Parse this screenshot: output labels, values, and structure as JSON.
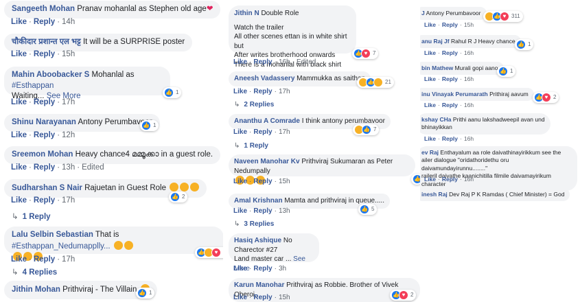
{
  "common": {
    "like": "Like",
    "reply": "Reply",
    "edited": "Edited",
    "see_more": "See More",
    "dot": "·"
  },
  "col1": {
    "c1": {
      "name": "Sangeeth Mohan",
      "text": "Pranav mohanlal as Stephen old age",
      "emoji": "heart",
      "time": "14h"
    },
    "c2": {
      "name": "चौकीदार प्रशान्त एल भट्ट",
      "text": "It will be a SURPRISE poster",
      "time": "15h"
    },
    "c3": {
      "name": "Mahin Aboobacker S",
      "text": "Mohanlal as",
      "tag": "#Esthappan",
      "text2": "Waiting...",
      "time": "17h",
      "reactions": {
        "icons": [
          "like"
        ],
        "count": "1"
      }
    },
    "c4": {
      "name": "Shinu Narayanan",
      "text": "Antony Perumbavoor",
      "time": "12h",
      "reactions": {
        "icons": [
          "like"
        ],
        "count": "1"
      }
    },
    "c5": {
      "name": "Sreemon Mohan",
      "text": "Heavy chance4 മമ്മൂക്കാ in a guest role.",
      "time": "13h"
    },
    "c6": {
      "name": "Sudharshan S Nair",
      "text": "Rajuetan in Guest Role",
      "emoji": "laugh",
      "time": "17h",
      "reactions": {
        "icons": [
          "like"
        ],
        "count": "2"
      },
      "replies": "1 Reply"
    },
    "c7": {
      "name": "Lalu Selbin Sebastian",
      "text": "That is",
      "tag": "#Esthappan_Nedumapplly...",
      "emoji": "love-eyes",
      "time": "17h",
      "reactions": {
        "icons": [
          "like",
          "haha",
          "love"
        ],
        "count": "3"
      },
      "replies": "4 Replies"
    },
    "c8": {
      "name": "Jithin Mohan",
      "text": "Prithviraj - The Villain",
      "emoji": "cool",
      "reactions": {
        "icons": [
          "like"
        ],
        "count": "1"
      }
    }
  },
  "col2": {
    "c1": {
      "name": "Jithin N",
      "text": "Double Role",
      "lines": [
        "Watch the trailer",
        "All other scenes ettan is in white shirt but",
        "After writes brotherhood onwards",
        "There is a mohanlal with black shirt"
      ],
      "time": "16h",
      "reactions": {
        "icons": [
          "like",
          "love"
        ],
        "count": "7"
      }
    },
    "c2": {
      "name": "Aneesh Vadassery",
      "text": "Mammukka as saithan",
      "time": "17h",
      "reactions": {
        "icons": [
          "haha",
          "like",
          "wow"
        ],
        "count": "21"
      },
      "replies": "2 Replies"
    },
    "c3": {
      "name": "Ananthu A Comrade",
      "text": "I think antony perumbavoor",
      "time": "17h",
      "reactions": {
        "icons": [
          "haha",
          "like"
        ],
        "count": "7"
      },
      "replies": "1 Reply"
    },
    "c4": {
      "name": "Naveen Manohar Kv",
      "text": "Prithviraj Sukumaran as Peter Nedumpally",
      "emoji": "love-eyes",
      "time": "15h",
      "reactions": {
        "icons": [
          "like"
        ],
        "count": ""
      }
    },
    "c5": {
      "name": "Amal Krishnan",
      "text": "Mamta and prithviraj in queue.....",
      "time": "13h",
      "reactions": {
        "icons": [
          "like"
        ],
        "count": "5"
      },
      "replies": "3 Replies"
    },
    "c6": {
      "name": "Hasiq Ashique",
      "text": "No",
      "lines": [
        "Charector #27",
        "Land master car ..."
      ],
      "time": "3h"
    },
    "c7": {
      "name": "Karun Manohar",
      "text": "Prithviraj as Robbie. Brother of Vivek Oberoi.",
      "time": "15h",
      "reactions": {
        "icons": [
          "like",
          "love"
        ],
        "count": "2"
      }
    }
  },
  "col3": {
    "c1": {
      "name": "J",
      "text": "Antony Perumbavoor",
      "time": "15h",
      "reactions": {
        "icons": [
          "haha",
          "like",
          "love"
        ],
        "count": "311"
      }
    },
    "c2": {
      "name": "anu Raj Jf",
      "text": "Rahul R J Heavy chance",
      "time": "16h",
      "reactions": {
        "icons": [
          "like"
        ],
        "count": "1"
      }
    },
    "c3": {
      "name": "bin Mathew",
      "text": "Murali gopi aano",
      "time": "16h",
      "reactions": {
        "icons": [
          "like"
        ],
        "count": "1"
      }
    },
    "c4": {
      "name": "inu Vinayak Perumarath",
      "text": "Prithiraj aavum",
      "time": "16h",
      "reactions": {
        "icons": [
          "like",
          "love"
        ],
        "count": "2"
      }
    },
    "c5": {
      "name": "kshay CHa",
      "text": "Prithi aanu lakshadweepil avan und",
      "text2": "bhinayikkan",
      "time": "16h"
    },
    "c6": {
      "name": "ev Raj",
      "text": "Enthayalum aa role daivathinayirikkum see the",
      "lines": [
        "ailer dialogue \"oridathoridethu oru daivamundayirunnu........\"",
        "raileril daivathe kaanichitilla filmile daivamayirikum character"
      ],
      "time": "16h"
    },
    "c7": {
      "name": "inesh Raj",
      "text": "Dev Raj P K Ramdas ( Chief Minister) = God"
    }
  }
}
